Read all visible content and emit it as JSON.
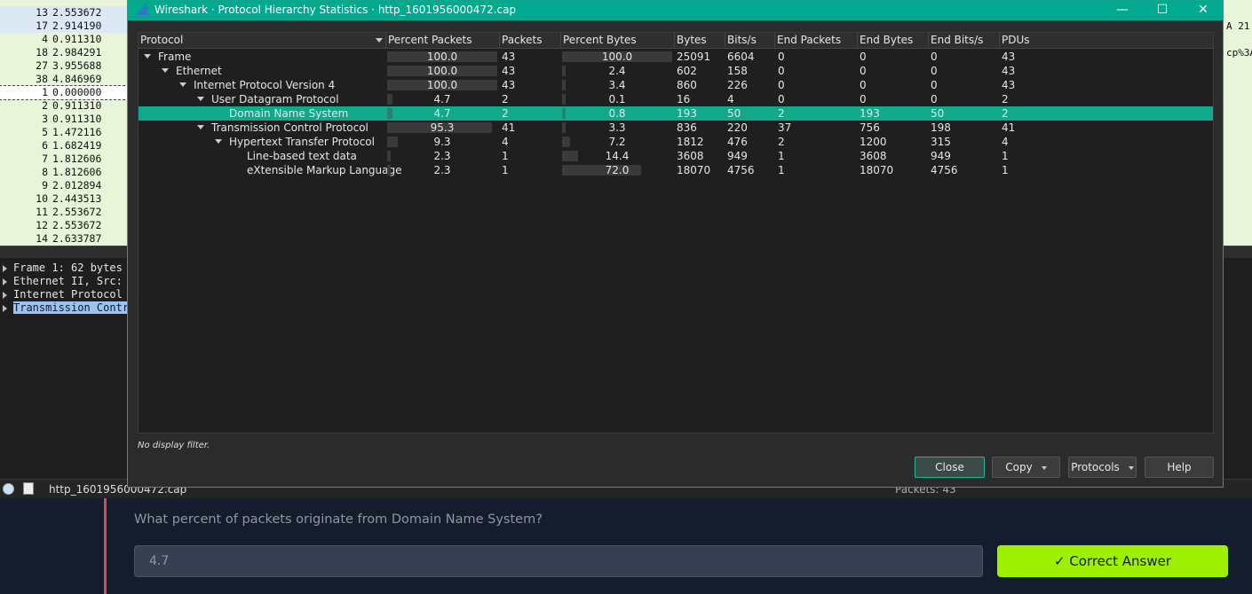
{
  "packet_list": [
    {
      "no": "13",
      "time": "2.553672"
    },
    {
      "no": "17",
      "time": "2.914190"
    },
    {
      "no": "4",
      "time": "0.911310"
    },
    {
      "no": "18",
      "time": "2.984291"
    },
    {
      "no": "27",
      "time": "3.955688"
    },
    {
      "no": "38",
      "time": "4.846969"
    },
    {
      "no": "1",
      "time": "0.000000"
    },
    {
      "no": "2",
      "time": "0.911310"
    },
    {
      "no": "3",
      "time": "0.911310"
    },
    {
      "no": "5",
      "time": "1.472116"
    },
    {
      "no": "6",
      "time": "1.682419"
    },
    {
      "no": "7",
      "time": "1.812606"
    },
    {
      "no": "8",
      "time": "1.812606"
    },
    {
      "no": "9",
      "time": "2.012894"
    },
    {
      "no": "10",
      "time": "2.443513"
    },
    {
      "no": "11",
      "time": "2.553672"
    },
    {
      "no": "12",
      "time": "2.553672"
    },
    {
      "no": "14",
      "time": "2.633787"
    }
  ],
  "right_strip": {
    "t1": "A 21",
    "t2": "cp%3A"
  },
  "details": [
    {
      "label": "Frame 1: 62 bytes"
    },
    {
      "label": "Ethernet II, Src: "
    },
    {
      "label": "Internet Protocol "
    },
    {
      "label": "Transmission Contr"
    }
  ],
  "status": {
    "file": "http_1601956000472.cap",
    "packets": "Packets: 43"
  },
  "dialog": {
    "title": "Wireshark · Protocol Hierarchy Statistics · http_1601956000472.cap",
    "win_minimize": "—",
    "win_maximize": "☐",
    "win_close": "✕",
    "columns": [
      "Protocol",
      "Percent Packets",
      "Packets",
      "Percent Bytes",
      "Bytes",
      "Bits/s",
      "End Packets",
      "End Bytes",
      "End Bits/s",
      "PDUs"
    ],
    "rows": [
      {
        "protocol": "Frame",
        "pct_packets": "100.0",
        "packets": "43",
        "pct_bytes": "100.0",
        "bytes": "25091",
        "bits": "6604",
        "end_packets": "0",
        "end_bytes": "0",
        "end_bits": "0",
        "pdus": "43"
      },
      {
        "protocol": "Ethernet",
        "pct_packets": "100.0",
        "packets": "43",
        "pct_bytes": "2.4",
        "bytes": "602",
        "bits": "158",
        "end_packets": "0",
        "end_bytes": "0",
        "end_bits": "0",
        "pdus": "43"
      },
      {
        "protocol": "Internet Protocol Version 4",
        "pct_packets": "100.0",
        "packets": "43",
        "pct_bytes": "3.4",
        "bytes": "860",
        "bits": "226",
        "end_packets": "0",
        "end_bytes": "0",
        "end_bits": "0",
        "pdus": "43"
      },
      {
        "protocol": "User Datagram Protocol",
        "pct_packets": "4.7",
        "packets": "2",
        "pct_bytes": "0.1",
        "bytes": "16",
        "bits": "4",
        "end_packets": "0",
        "end_bytes": "0",
        "end_bits": "0",
        "pdus": "2"
      },
      {
        "protocol": "Domain Name System",
        "pct_packets": "4.7",
        "packets": "2",
        "pct_bytes": "0.8",
        "bytes": "193",
        "bits": "50",
        "end_packets": "2",
        "end_bytes": "193",
        "end_bits": "50",
        "pdus": "2"
      },
      {
        "protocol": "Transmission Control Protocol",
        "pct_packets": "95.3",
        "packets": "41",
        "pct_bytes": "3.3",
        "bytes": "836",
        "bits": "220",
        "end_packets": "37",
        "end_bytes": "756",
        "end_bits": "198",
        "pdus": "41"
      },
      {
        "protocol": "Hypertext Transfer Protocol",
        "pct_packets": "9.3",
        "packets": "4",
        "pct_bytes": "7.2",
        "bytes": "1812",
        "bits": "476",
        "end_packets": "2",
        "end_bytes": "1200",
        "end_bits": "315",
        "pdus": "4"
      },
      {
        "protocol": "Line-based text data",
        "pct_packets": "2.3",
        "packets": "1",
        "pct_bytes": "14.4",
        "bytes": "3608",
        "bits": "949",
        "end_packets": "1",
        "end_bytes": "3608",
        "end_bits": "949",
        "pdus": "1"
      },
      {
        "protocol": "eXtensible Markup Language",
        "pct_packets": "2.3",
        "packets": "1",
        "pct_bytes": "72.0",
        "bytes": "18070",
        "bits": "4756",
        "end_packets": "1",
        "end_bytes": "18070",
        "end_bits": "4756",
        "pdus": "1"
      }
    ],
    "filter": "No display filter.",
    "buttons": {
      "close": "Close",
      "copy": "Copy",
      "protocols": "Protocols",
      "help": "Help"
    }
  },
  "quiz": {
    "question": "What percent of packets originate from Domain Name System?",
    "answer": "4.7",
    "button": "✓ Correct Answer",
    "accent": "#9fef00"
  }
}
